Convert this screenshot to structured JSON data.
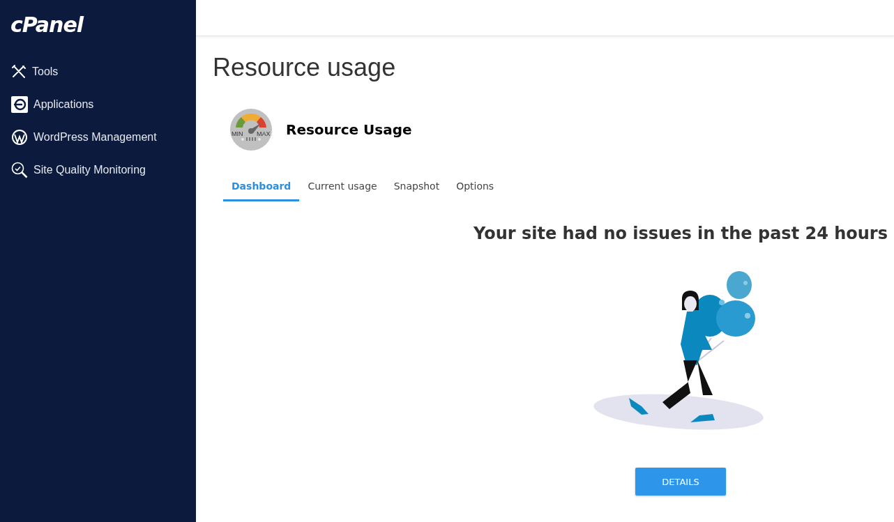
{
  "sidebar": {
    "logo": "cPanel",
    "items": [
      {
        "label": "Tools"
      },
      {
        "label": "Applications"
      },
      {
        "label": "WordPress Management"
      },
      {
        "label": "Site Quality Monitoring"
      }
    ]
  },
  "page_title": "Resource usage",
  "app": {
    "title": "Resource Usage",
    "gauge_labels": [
      "MIN",
      "MAX"
    ]
  },
  "tabs": [
    {
      "label": "Dashboard",
      "selected": true
    },
    {
      "label": "Current usage",
      "selected": false
    },
    {
      "label": "Snapshot",
      "selected": false
    },
    {
      "label": "Options",
      "selected": false
    }
  ],
  "message": "Your site had no issues in the past 24 hours",
  "details_button": "DETAILS"
}
